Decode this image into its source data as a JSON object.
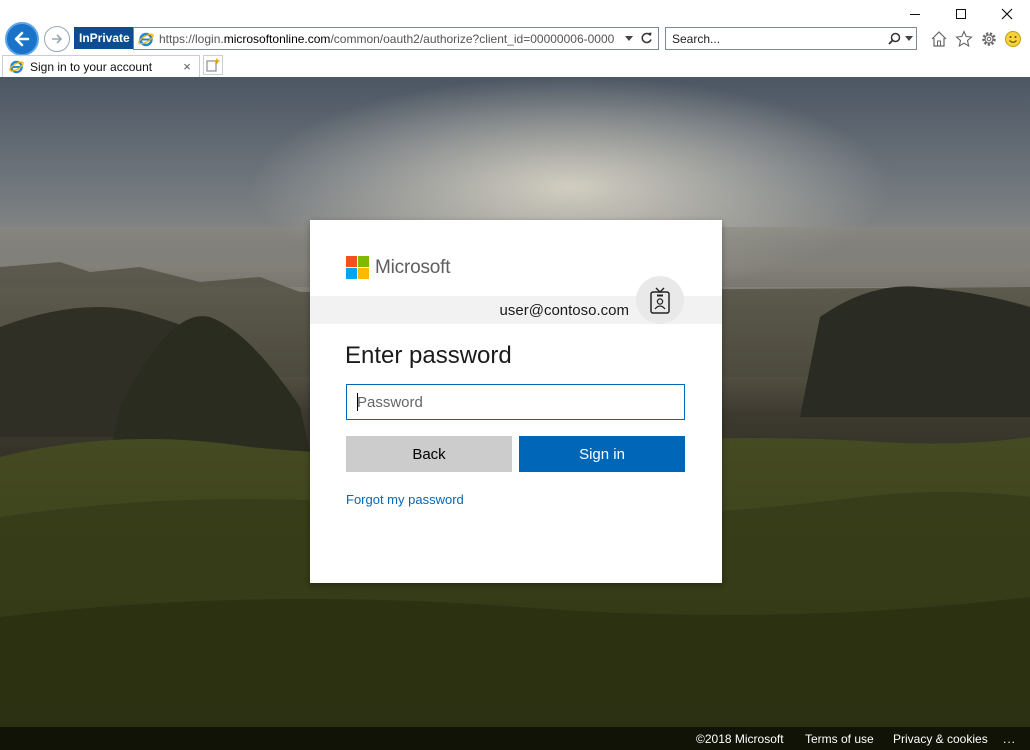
{
  "browser": {
    "inprivate_label": "InPrivate",
    "url_prefix": "https://login.",
    "url_domain": "microsoftonline.com",
    "url_suffix": "/common/oauth2/authorize?client_id=00000006-0000",
    "search_placeholder": "Search...",
    "tab_title": "Sign in to your account",
    "tab_close": "×"
  },
  "card": {
    "brand": "Microsoft",
    "identity_email": "user@contoso.com",
    "title": "Enter password",
    "password_placeholder": "Password",
    "back_label": "Back",
    "signin_label": "Sign in",
    "forgot_label": "Forgot my password"
  },
  "footer": {
    "copyright": "©2018 Microsoft",
    "terms": "Terms of use",
    "privacy": "Privacy & cookies",
    "more": "..."
  },
  "colors": {
    "accent": "#0067b8",
    "logo_red": "#f25022",
    "logo_green": "#7fba00",
    "logo_blue": "#00a4ef",
    "logo_yellow": "#ffb900"
  },
  "icons": [
    "back-arrow-icon",
    "forward-arrow-icon",
    "ie-icon",
    "refresh-icon",
    "search-icon",
    "home-icon",
    "star-icon",
    "gear-icon",
    "smiley-icon",
    "badge-icon"
  ]
}
